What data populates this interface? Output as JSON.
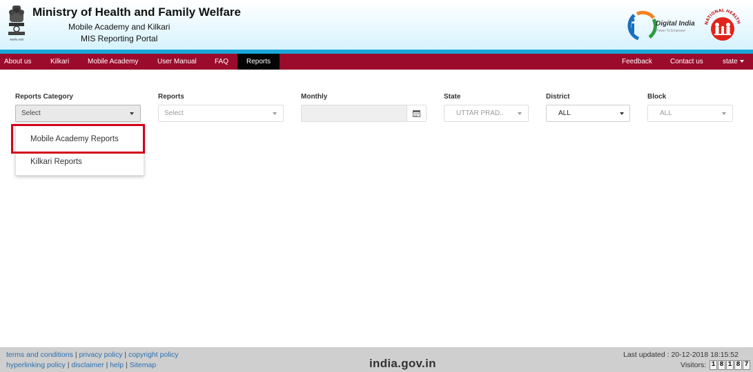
{
  "header": {
    "ministry_title": "Ministry of Health and Family Welfare",
    "subtitle_line1": "Mobile Academy and Kilkari",
    "subtitle_line2": "MIS Reporting Portal",
    "digital_india_text": "Digital India",
    "digital_india_tagline": "Power To Empower",
    "emblem_caption": "सत्यमेव जयते",
    "nhm_text": "NATIONAL HEALTH MISSION",
    "icons": [
      "state-emblem-icon",
      "digital-india-logo-icon",
      "nhm-logo-icon"
    ]
  },
  "nav": {
    "left": [
      "About us",
      "Kilkari",
      "Mobile Academy",
      "User Manual",
      "FAQ",
      "Reports"
    ],
    "active": "Reports",
    "right": [
      "Feedback",
      "Contact us",
      "state"
    ]
  },
  "filters": {
    "reports_category": {
      "label": "Reports Category",
      "value": "Select"
    },
    "reports": {
      "label": "Reports",
      "value": "Select"
    },
    "monthly": {
      "label": "Monthly",
      "value": ""
    },
    "state": {
      "label": "State",
      "value": "UTTAR PRAD.."
    },
    "district": {
      "label": "District",
      "value": "ALL"
    },
    "block": {
      "label": "Block",
      "value": "ALL"
    }
  },
  "dropdown": {
    "options": [
      "Mobile Academy Reports",
      "Kilkari Reports"
    ],
    "highlighted": "Mobile Academy Reports"
  },
  "footer": {
    "links_row1": [
      "terms and conditions",
      "privacy policy",
      "copyright policy"
    ],
    "links_row2": [
      "hyperlinking policy",
      "disclaimer",
      "help",
      "Sitemap"
    ],
    "separator": "|",
    "india_gov": "india.gov.in",
    "last_updated": "Last updated : 20-12-2018 18:15:52",
    "visitors_label": "Visitors:",
    "visitor_digits": [
      "1",
      "8",
      "1",
      "8",
      "7"
    ]
  },
  "colors": {
    "nav_bg": "#9b0b2c",
    "nav_active": "#050505",
    "header_stripe": "#1aa6d8",
    "highlight": "#d0021b",
    "link": "#2a6fb0",
    "footer_bg": "#cfcfcf"
  }
}
